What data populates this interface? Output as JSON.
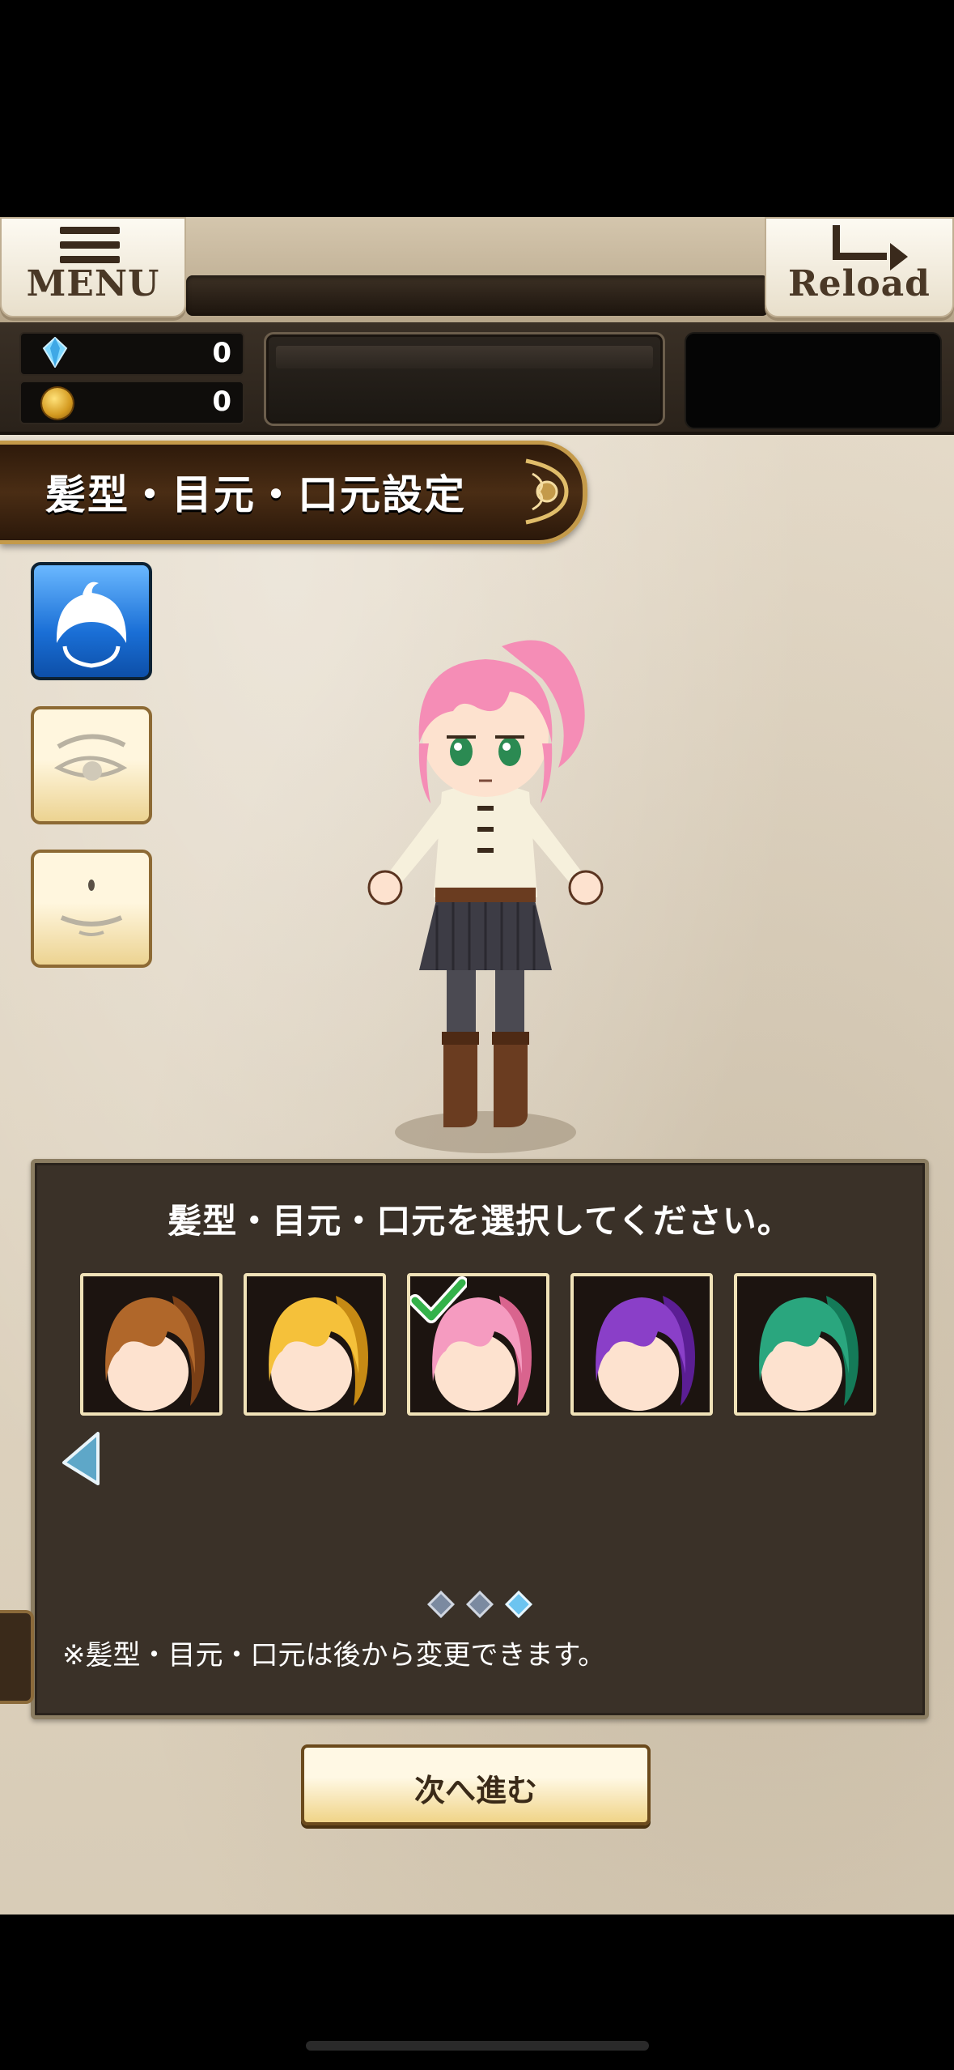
{
  "header": {
    "menu_label": "MENU",
    "reload_label": "Reload"
  },
  "currency": {
    "gems": "0",
    "coins": "0"
  },
  "title": "髪型・目元・口元設定",
  "tabs": [
    {
      "name": "hair",
      "icon": "hair-icon",
      "selected": true
    },
    {
      "name": "eyes",
      "icon": "eye-icon",
      "selected": false
    },
    {
      "name": "mouth",
      "icon": "mouth-icon",
      "selected": false
    }
  ],
  "panel": {
    "prompt": "髪型・目元・口元を選択してください。",
    "note": "※髪型・目元・口元は後から変更できます。",
    "page_index": 3,
    "page_count": 3,
    "hair_options": [
      {
        "color": "#b0672a",
        "dark": "#7a3f16",
        "selected": false
      },
      {
        "color": "#f5c13a",
        "dark": "#c68a14",
        "selected": false
      },
      {
        "color": "#f59bc0",
        "dark": "#d9648e",
        "selected": true
      },
      {
        "color": "#8a3fc8",
        "dark": "#5b1e94",
        "selected": false
      },
      {
        "color": "#2aa67e",
        "dark": "#147a58",
        "selected": false
      }
    ]
  },
  "next_button": "次へ進む"
}
